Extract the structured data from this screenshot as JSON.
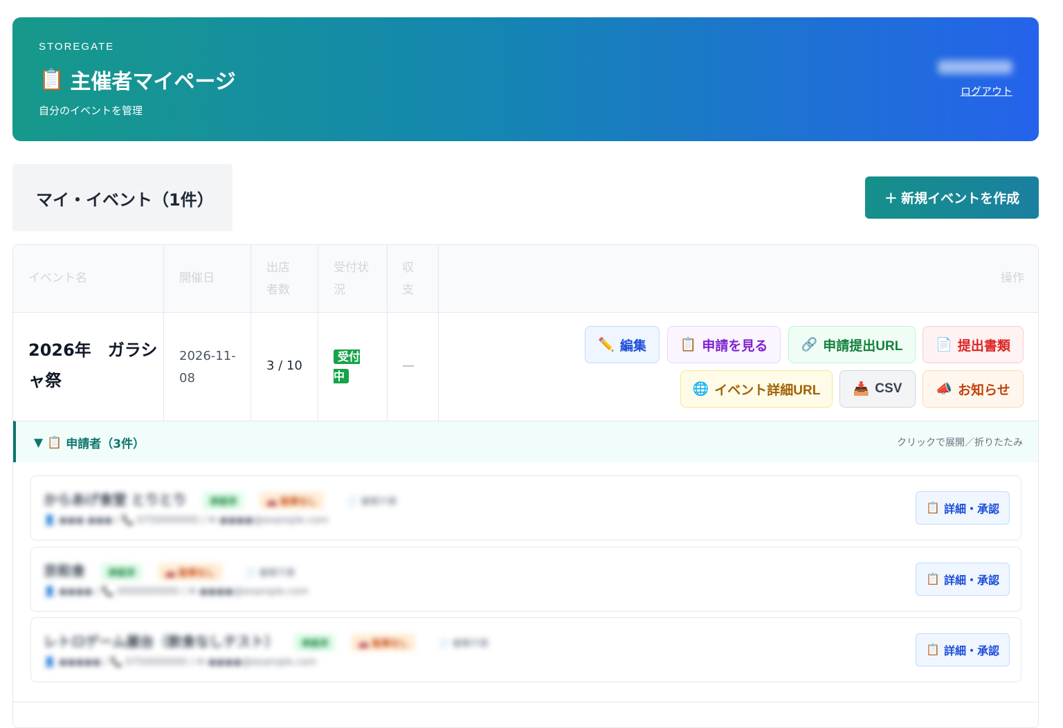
{
  "header": {
    "brand": "STOREGATE",
    "title_icon": "📋",
    "title": "主催者マイページ",
    "subtitle": "自分のイベントを管理",
    "user_name": "",
    "logout_label": "ログアウト"
  },
  "section": {
    "title": "マイ・イベント（1件）",
    "new_event_label": "＋ 新規イベントを作成"
  },
  "table": {
    "columns": [
      "イベント名",
      "開催日",
      "出店者数",
      "受付状況",
      "収支",
      "操作"
    ],
    "rows": [
      {
        "name": "2026年　ガラシャ祭",
        "date": "2026-11-08",
        "count": "3 / 10",
        "status": "受付中",
        "balance": "—",
        "actions": {
          "edit": "編集",
          "applications": "申請を見る",
          "submit_url": "申請提出URL",
          "documents": "提出書類",
          "detail_url": "イベント詳細URL",
          "csv": "CSV",
          "notice": "お知らせ"
        }
      }
    ]
  },
  "applicants": {
    "toggle": "▼",
    "title": "申請者（3件）",
    "hint": "クリックで展開／折りたたみ",
    "approve_label": "詳細・承認",
    "items": [
      {
        "name": "からあげ食堂 とりとり",
        "tag1": "承認済",
        "tag2": "🚗 駐車なし",
        "tag3": "📄 書類不要",
        "contact": "👤 ●●● ●●● / 📞 0750000000 / ✉ ●●●●@example.com"
      },
      {
        "name": "京和食",
        "tag1": "承認済",
        "tag2": "🚗 駐車なし",
        "tag3": "📄 書類不要",
        "contact": "👤 ●●●● / 📞 0000000000 / ✉ ●●●●@example.com"
      },
      {
        "name": "レトロゲーム屋台（飲食なしテスト）",
        "tag1": "承認済",
        "tag2": "🚗 駐車なし",
        "tag3": "📄 書類不要",
        "contact": "👤 ●●●●● / 📞 0750000000 / ✉ ●●●●@example.com"
      }
    ]
  },
  "colors": {
    "header_start": "#17998a",
    "header_end": "#2563eb",
    "status_green": "#16a34a",
    "accent_teal": "#0f766e"
  }
}
